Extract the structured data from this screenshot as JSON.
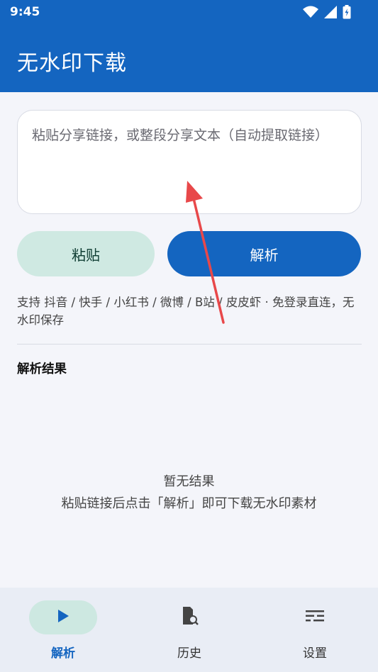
{
  "status_bar": {
    "time": "9:45"
  },
  "app_bar": {
    "title": "无水印下载"
  },
  "input": {
    "placeholder": "粘贴分享链接，或整段分享文本（自动提取链接）",
    "value": ""
  },
  "buttons": {
    "paste": "粘贴",
    "parse": "解析"
  },
  "support_text": "支持 抖音 / 快手 / 小红书 / 微博 / B站 / 皮皮虾 · 免登录直连，无水印保存",
  "results": {
    "title": "解析结果",
    "empty_title": "暂无结果",
    "empty_hint": "粘贴链接后点击「解析」即可下载无水印素材"
  },
  "bottom_nav": [
    {
      "label": "解析",
      "icon": "play-icon",
      "active": true
    },
    {
      "label": "历史",
      "icon": "history-icon",
      "active": false
    },
    {
      "label": "设置",
      "icon": "settings-icon",
      "active": false
    }
  ],
  "colors": {
    "primary": "#1465c0",
    "secondary_container": "#cfe9e2",
    "background": "#f4f5fa",
    "annotation_arrow": "#e8484a"
  }
}
